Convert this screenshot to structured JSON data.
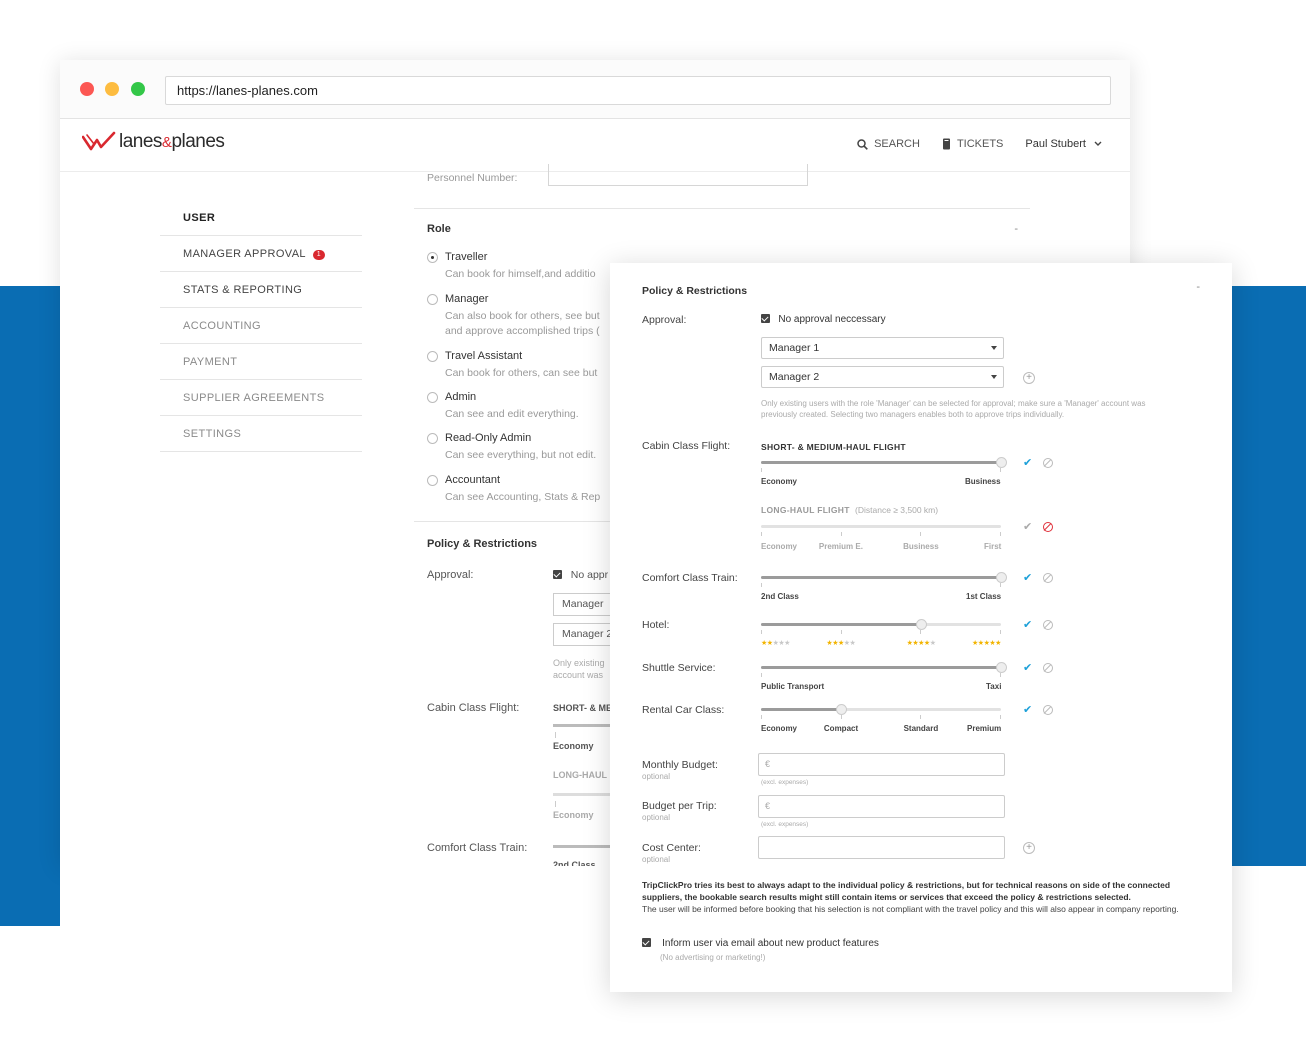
{
  "browser": {
    "url": "https://lanes-planes.com"
  },
  "app": {
    "logo_main": "lanes",
    "logo_amp": "&",
    "logo_end": "planes",
    "nav": {
      "search": "SEARCH",
      "tickets": "TICKETS",
      "user": "Paul Stubert"
    }
  },
  "sidebar": {
    "items": [
      {
        "label": "USER"
      },
      {
        "label": "MANAGER APPROVAL",
        "badge": "1"
      },
      {
        "label": "STATS & REPORTING"
      },
      {
        "label": "ACCOUNTING"
      },
      {
        "label": "PAYMENT"
      },
      {
        "label": "SUPPLIER AGREEMENTS"
      },
      {
        "label": "SETTINGS"
      }
    ]
  },
  "main": {
    "personnel_label": "Personnel Number:",
    "role_title": "Role",
    "role_toggle": "-",
    "roles": [
      {
        "name": "Traveller",
        "desc": "Can book for himself,and additio"
      },
      {
        "name": "Manager",
        "desc": "Can also book for others, see but",
        "desc2": "and approve accomplished trips ("
      },
      {
        "name": "Travel Assistant",
        "desc": "Can book for others, can see but"
      },
      {
        "name": "Admin",
        "desc": "Can see and edit everything."
      },
      {
        "name": "Read-Only Admin",
        "desc": "Can see everything, but not edit."
      },
      {
        "name": "Accountant",
        "desc": "Can see Accounting, Stats & Rep"
      }
    ],
    "policy_title": "Policy & Restrictions",
    "approval_label": "Approval:",
    "approval_value": "No appr",
    "manager1": "Manager",
    "manager2": "Manager 2",
    "hint1": "Only existing",
    "hint2": "account was",
    "cabin_label": "Cabin Class Flight:",
    "cabin_head": "SHORT- & ME",
    "economy": "Economy",
    "longhaul": "LONG-HAUL",
    "economy2": "Economy",
    "comfort_label": "Comfort Class Train:",
    "second_class": "2nd Class"
  },
  "panel": {
    "title": "Policy & Restrictions",
    "toggle": "-",
    "approval_label": "Approval:",
    "approval_checkbox": "No approval neccessary",
    "manager1": "Manager 1",
    "manager2": "Manager 2",
    "hint": "Only existing users with the role 'Manager' can be selected for approval; make sure a 'Manager' account was previously created. Selecting two managers enables both to approve trips individually.",
    "cabin_label": "Cabin Class Flight:",
    "short_head": "SHORT- & MEDIUM-HAUL FLIGHT",
    "short_labels": [
      "Economy",
      "Business"
    ],
    "short_level": 1.0,
    "long_head": "LONG-HAUL FLIGHT",
    "long_extra": "(Distance ≥ 3,500 km)",
    "long_labels": [
      "Economy",
      "Premium E.",
      "Business",
      "First"
    ],
    "train_label": "Comfort Class Train:",
    "train_labels": [
      "2nd Class",
      "1st Class"
    ],
    "train_level": 1.0,
    "hotel_label": "Hotel:",
    "hotel_stars": [
      2,
      3,
      4,
      5
    ],
    "hotel_level": 0.667,
    "shuttle_label": "Shuttle Service:",
    "shuttle_labels": [
      "Public Transport",
      "Taxi"
    ],
    "shuttle_level": 1.0,
    "rental_label": "Rental Car Class:",
    "rental_labels": [
      "Economy",
      "Compact",
      "Standard",
      "Premium"
    ],
    "rental_level": 0.333,
    "monthly_label": "Monthly Budget:",
    "monthly_sub": "optional",
    "currency": "€",
    "excl": "(excl. expenses)",
    "trip_label": "Budget per Trip:",
    "trip_sub": "optional",
    "cost_label": "Cost Center:",
    "cost_sub": "optional",
    "note_bold": "TripClickPro tries its best to always adapt to the individual policy & restrictions, but for technical reasons on side of the connected suppliers, the bookable search results might still contain items or services that exceed the policy & restrictions selected.",
    "note_regular": "The user will be informed before booking that his selection is not compliant with the travel policy and this will also appear in company reporting.",
    "inform_label": "Inform user via email about new product features",
    "inform_sub": "(No advertising or marketing!)"
  },
  "colors": {
    "brand_blue": "#0a6db3",
    "brand_red": "#d9282f",
    "check_blue": "#1ca0d8",
    "star": "#f2b400"
  }
}
